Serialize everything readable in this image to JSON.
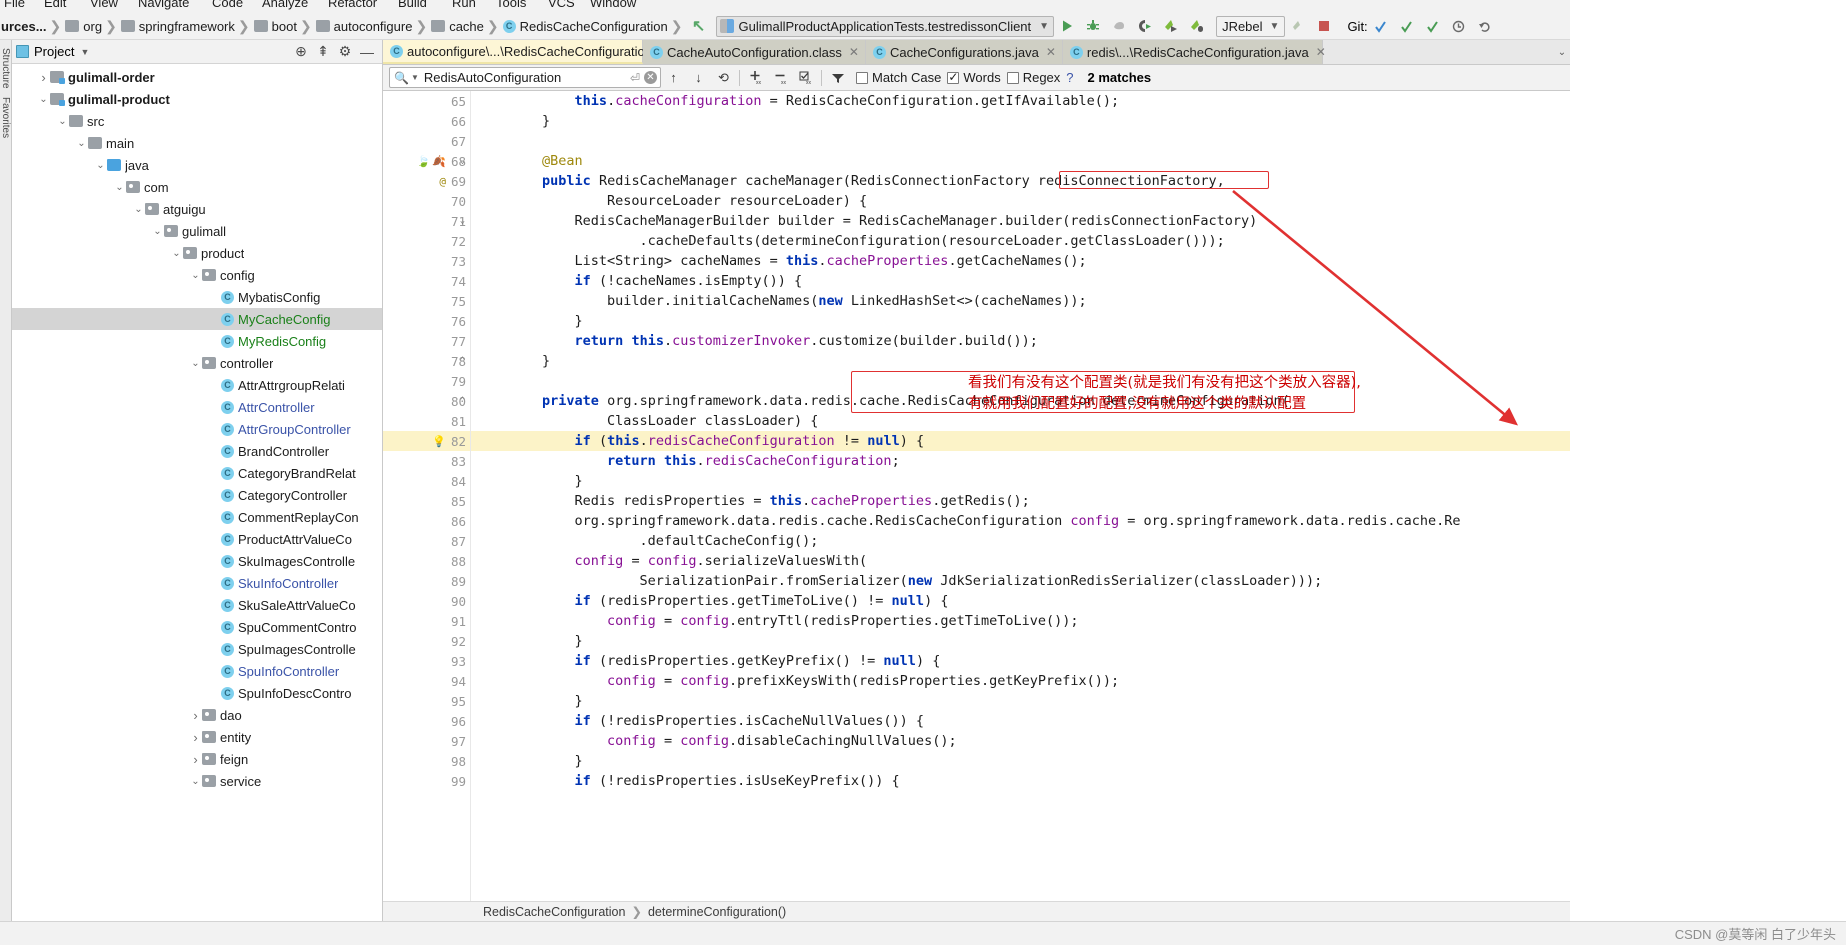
{
  "menu": {
    "items": [
      "File",
      "Edit",
      "View",
      "Navigate",
      "Code",
      "Analyze",
      "Refactor",
      "Build",
      "Run",
      "Tools",
      "VCS",
      "Window"
    ]
  },
  "navbar": {
    "crumbs": [
      {
        "label": "urces...",
        "icon": "none",
        "bold": true
      },
      {
        "label": "org",
        "icon": "folder"
      },
      {
        "label": "springframework",
        "icon": "folder"
      },
      {
        "label": "boot",
        "icon": "folder"
      },
      {
        "label": "autoconfigure",
        "icon": "folder"
      },
      {
        "label": "cache",
        "icon": "folder"
      },
      {
        "label": "RedisCacheConfiguration",
        "icon": "class"
      }
    ],
    "back_icon": "back-arrow-icon",
    "run_config": "GulimallProductApplicationTests.testredissonClient",
    "toolbar_icons": [
      "run-icon",
      "debug-icon",
      "coverage-icon",
      "profile-icon",
      "jrebel-run-icon",
      "jrebel-debug-icon"
    ],
    "jrebel_label": "JRebel",
    "git_label": "Git:",
    "git_icons": [
      "update-project-icon",
      "commit-icon",
      "push-icon",
      "history-icon",
      "undo-icon"
    ]
  },
  "left_strip": {
    "labels": [
      "Structure",
      "Favorites"
    ]
  },
  "project_panel": {
    "title": "Project",
    "header_icons": [
      "locate-icon",
      "collapse-all-icon",
      "settings-icon",
      "hide-icon"
    ],
    "tree": [
      {
        "indent": 1,
        "arrow": "right",
        "icon": "module-folder",
        "label": "gulimall-order",
        "style": "bold-black"
      },
      {
        "indent": 1,
        "arrow": "down",
        "icon": "module-folder",
        "label": "gulimall-product",
        "style": "bold-black"
      },
      {
        "indent": 2,
        "arrow": "down",
        "icon": "folder",
        "label": "src",
        "style": "black"
      },
      {
        "indent": 3,
        "arrow": "down",
        "icon": "folder",
        "label": "main",
        "style": "black"
      },
      {
        "indent": 4,
        "arrow": "down",
        "icon": "source-folder",
        "label": "java",
        "style": "black"
      },
      {
        "indent": 5,
        "arrow": "down",
        "icon": "package",
        "label": "com",
        "style": "black"
      },
      {
        "indent": 6,
        "arrow": "down",
        "icon": "package",
        "label": "atguigu",
        "style": "black"
      },
      {
        "indent": 7,
        "arrow": "down",
        "icon": "package",
        "label": "gulimall",
        "style": "black"
      },
      {
        "indent": 8,
        "arrow": "down",
        "icon": "package",
        "label": "product",
        "style": "black"
      },
      {
        "indent": 9,
        "arrow": "down",
        "icon": "package",
        "label": "config",
        "style": "black"
      },
      {
        "indent": 10,
        "arrow": "none",
        "icon": "class",
        "label": "MybatisConfig",
        "style": "black"
      },
      {
        "indent": 10,
        "arrow": "none",
        "icon": "class",
        "label": "MyCacheConfig",
        "style": "green",
        "selected": true
      },
      {
        "indent": 10,
        "arrow": "none",
        "icon": "class",
        "label": "MyRedisConfig",
        "style": "green"
      },
      {
        "indent": 9,
        "arrow": "down",
        "icon": "package",
        "label": "controller",
        "style": "black"
      },
      {
        "indent": 10,
        "arrow": "none",
        "icon": "class",
        "label": "AttrAttrgroupRelati",
        "style": "black"
      },
      {
        "indent": 10,
        "arrow": "none",
        "icon": "class",
        "label": "AttrController",
        "style": "blue"
      },
      {
        "indent": 10,
        "arrow": "none",
        "icon": "class",
        "label": "AttrGroupController",
        "style": "blue"
      },
      {
        "indent": 10,
        "arrow": "none",
        "icon": "class",
        "label": "BrandController",
        "style": "black"
      },
      {
        "indent": 10,
        "arrow": "none",
        "icon": "class",
        "label": "CategoryBrandRelat",
        "style": "black"
      },
      {
        "indent": 10,
        "arrow": "none",
        "icon": "class",
        "label": "CategoryController",
        "style": "black"
      },
      {
        "indent": 10,
        "arrow": "none",
        "icon": "class",
        "label": "CommentReplayCon",
        "style": "black"
      },
      {
        "indent": 10,
        "arrow": "none",
        "icon": "class",
        "label": "ProductAttrValueCo",
        "style": "black"
      },
      {
        "indent": 10,
        "arrow": "none",
        "icon": "class",
        "label": "SkuImagesControlle",
        "style": "black"
      },
      {
        "indent": 10,
        "arrow": "none",
        "icon": "class",
        "label": "SkuInfoController",
        "style": "blue"
      },
      {
        "indent": 10,
        "arrow": "none",
        "icon": "class",
        "label": "SkuSaleAttrValueCo",
        "style": "black"
      },
      {
        "indent": 10,
        "arrow": "none",
        "icon": "class",
        "label": "SpuCommentContro",
        "style": "black"
      },
      {
        "indent": 10,
        "arrow": "none",
        "icon": "class",
        "label": "SpuImagesControlle",
        "style": "black"
      },
      {
        "indent": 10,
        "arrow": "none",
        "icon": "class",
        "label": "SpuInfoController",
        "style": "blue"
      },
      {
        "indent": 10,
        "arrow": "none",
        "icon": "class",
        "label": "SpuInfoDescContro",
        "style": "black"
      },
      {
        "indent": 9,
        "arrow": "right",
        "icon": "package",
        "label": "dao",
        "style": "black"
      },
      {
        "indent": 9,
        "arrow": "right",
        "icon": "package",
        "label": "entity",
        "style": "black"
      },
      {
        "indent": 9,
        "arrow": "right",
        "icon": "package",
        "label": "feign",
        "style": "black"
      },
      {
        "indent": 9,
        "arrow": "down",
        "icon": "package",
        "label": "service",
        "style": "black"
      }
    ]
  },
  "editor": {
    "tabs": [
      {
        "label": "autoconfigure\\...\\RedisCacheConfiguration.java",
        "icon": "java-class-icon",
        "active": true
      },
      {
        "label": "CacheAutoConfiguration.class",
        "icon": "java-class-icon",
        "active": false
      },
      {
        "label": "CacheConfigurations.java",
        "icon": "java-class-icon",
        "active": false
      },
      {
        "label": "redis\\...\\RedisCacheConfiguration.java",
        "icon": "java-class-icon",
        "active": false
      }
    ],
    "find": {
      "value": "RedisAutoConfiguration",
      "icons": [
        "search-icon",
        "history-chevron-icon",
        "enter-icon",
        "clear-icon"
      ],
      "nav_icons": [
        "prev-occurrence-icon",
        "next-occurrence-icon",
        "select-all-icon",
        "add-selection-icon",
        "remove-selection-icon",
        "select-all-occurrences-icon",
        "filter-icon"
      ],
      "match_case": {
        "label": "Match Case",
        "checked": false
      },
      "words": {
        "label": "Words",
        "checked": true
      },
      "regex": {
        "label": "Regex",
        "checked": false
      },
      "help": "?",
      "matches": "2 matches"
    },
    "first_line": 65,
    "lines": [
      {
        "n": 65,
        "text": "            this.cacheConfiguration = RedisCacheConfiguration.getIfAvailable();",
        "clipped": true
      },
      {
        "n": 66,
        "text": "        }"
      },
      {
        "n": 67,
        "text": ""
      },
      {
        "n": 68,
        "text": "        @Bean",
        "marks": [
          "bean-gutter-icon",
          "override-gutter-icon"
        ]
      },
      {
        "n": 69,
        "text": "        public RedisCacheManager cacheManager(RedisConnectionFactory redisConnectionFactory,",
        "marks": [
          "annotation-gutter-icon"
        ]
      },
      {
        "n": 70,
        "text": "                ResourceLoader resourceLoader) {"
      },
      {
        "n": 71,
        "text": "            RedisCacheManagerBuilder builder = RedisCacheManager.builder(redisConnectionFactory)"
      },
      {
        "n": 72,
        "text": "                    .cacheDefaults(determineConfiguration(resourceLoader.getClassLoader()));"
      },
      {
        "n": 73,
        "text": "            List<String> cacheNames = this.cacheProperties.getCacheNames();"
      },
      {
        "n": 74,
        "text": "            if (!cacheNames.isEmpty()) {"
      },
      {
        "n": 75,
        "text": "                builder.initialCacheNames(new LinkedHashSet<>(cacheNames));"
      },
      {
        "n": 76,
        "text": "            }"
      },
      {
        "n": 77,
        "text": "            return this.customizerInvoker.customize(builder.build());"
      },
      {
        "n": 78,
        "text": "        }"
      },
      {
        "n": 79,
        "text": ""
      },
      {
        "n": 80,
        "text": "        private org.springframework.data.redis.cache.RedisCacheConfiguration determineConfiguration("
      },
      {
        "n": 81,
        "text": "                ClassLoader classLoader) {"
      },
      {
        "n": 82,
        "text": "            if (this.redisCacheConfiguration != null) {",
        "highlight": true,
        "marks": [
          "bulb-icon"
        ]
      },
      {
        "n": 83,
        "text": "                return this.redisCacheConfiguration;"
      },
      {
        "n": 84,
        "text": "            }"
      },
      {
        "n": 85,
        "text": "            Redis redisProperties = this.cacheProperties.getRedis();"
      },
      {
        "n": 86,
        "text": "            org.springframework.data.redis.cache.RedisCacheConfiguration config = org.springframework.data.redis.cache.Re"
      },
      {
        "n": 87,
        "text": "                    .defaultCacheConfig();"
      },
      {
        "n": 88,
        "text": "            config = config.serializeValuesWith("
      },
      {
        "n": 89,
        "text": "                    SerializationPair.fromSerializer(new JdkSerializationRedisSerializer(classLoader)));"
      },
      {
        "n": 90,
        "text": "            if (redisProperties.getTimeToLive() != null) {"
      },
      {
        "n": 91,
        "text": "                config = config.entryTtl(redisProperties.getTimeToLive());"
      },
      {
        "n": 92,
        "text": "            }"
      },
      {
        "n": 93,
        "text": "            if (redisProperties.getKeyPrefix() != null) {"
      },
      {
        "n": 94,
        "text": "                config = config.prefixKeysWith(redisProperties.getKeyPrefix());"
      },
      {
        "n": 95,
        "text": "            }"
      },
      {
        "n": 96,
        "text": "            if (!redisProperties.isCacheNullValues()) {"
      },
      {
        "n": 97,
        "text": "                config = config.disableCachingNullValues();"
      },
      {
        "n": 98,
        "text": "            }"
      },
      {
        "n": 99,
        "text": "            if (!redisProperties.isUseKeyPrefix()) {"
      }
    ],
    "breadcrumbs": [
      "RedisCacheConfiguration",
      "determineConfiguration()"
    ]
  },
  "annotations": {
    "accent_color": "#e03131",
    "text_color": "#cc0000",
    "line1": "看我们有没有这个配置类(就是我们有没有把这个类放入容器),",
    "line2": "有就用我们配置好的配置,没有就用这个类的默认配置",
    "arrow": "red-arrow-icon",
    "boxes": [
      "determineConfiguration-box",
      "if-redisCacheConfiguration-box"
    ]
  },
  "statusbar": {
    "watermark": "CSDN @莫等闲 白了少年头"
  }
}
